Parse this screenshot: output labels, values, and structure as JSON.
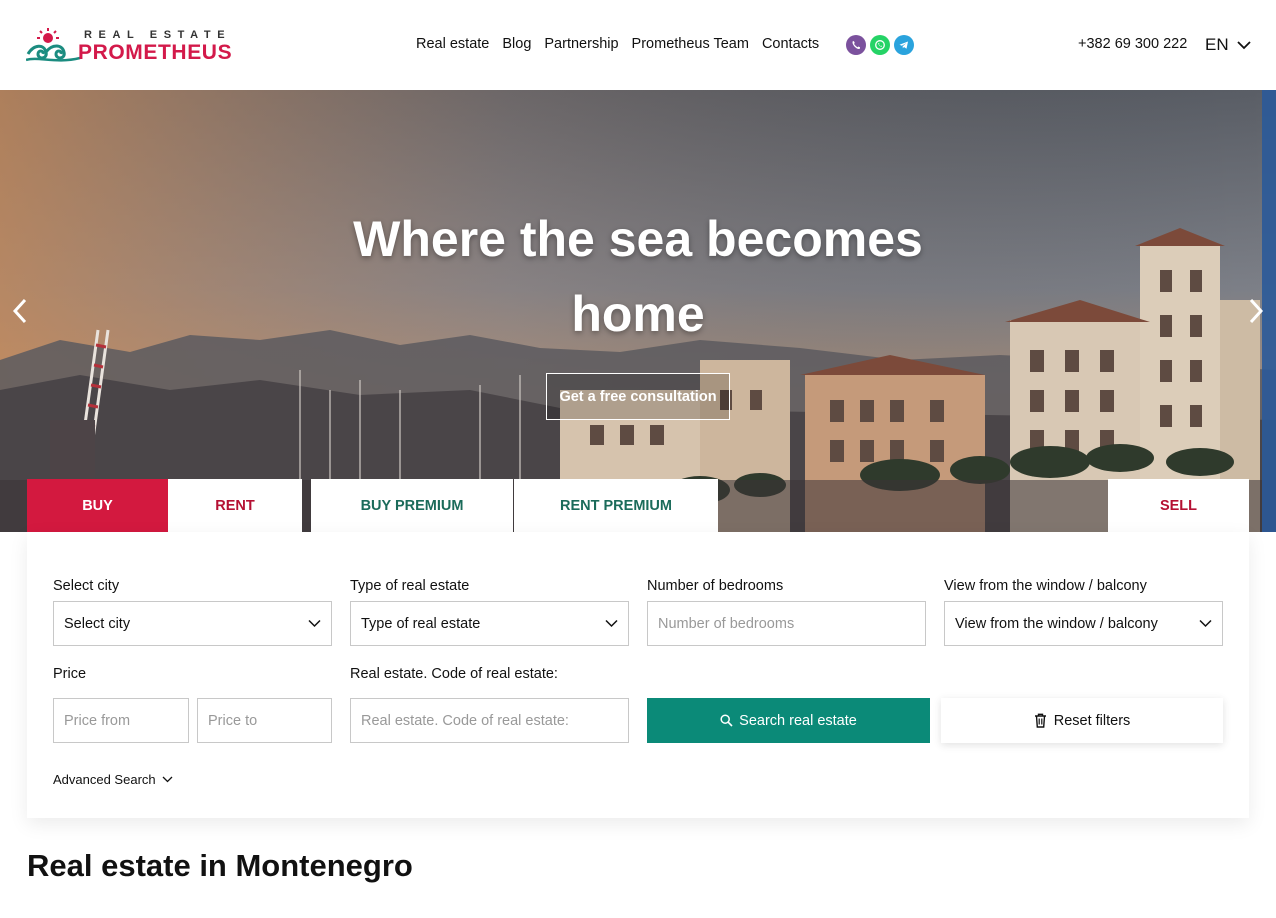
{
  "brand": {
    "tagline": "REAL ESTATE",
    "name": "PROMETHEUS",
    "colors": {
      "primary": "#d3193f",
      "teal": "#0b8a78",
      "dark_teal": "#1b6b5a"
    },
    "logo_icon": "sun-waves-logo"
  },
  "nav": {
    "items": [
      "Real estate",
      "Blog",
      "Partnership",
      "Prometheus Team",
      "Contacts"
    ]
  },
  "messengers": [
    {
      "icon": "viber-icon",
      "color": "#7b519d"
    },
    {
      "icon": "whatsapp-icon",
      "color": "#25d366"
    },
    {
      "icon": "telegram-icon",
      "color": "#2aa3dd"
    }
  ],
  "header": {
    "phone": "+382 69 300 222",
    "language": "EN"
  },
  "hero": {
    "title": "Where the sea becomes home",
    "cta": "Get a free consultation",
    "prev_icon": "chevron-left-icon",
    "next_icon": "chevron-right-icon"
  },
  "tabs": {
    "buy": "BUY",
    "rent": "RENT",
    "buy_premium": "BUY PREMIUM",
    "rent_premium": "RENT PREMIUM",
    "sell": "SELL",
    "active": "BUY"
  },
  "filters": {
    "city": {
      "label": "Select city",
      "value": "Select city"
    },
    "type": {
      "label": "Type of real estate",
      "value": "Type of real estate"
    },
    "bedrooms": {
      "label": "Number of bedrooms",
      "placeholder": "Number of bedrooms"
    },
    "view": {
      "label": "View from the window / balcony",
      "value": "View from the window / balcony"
    },
    "price": {
      "label": "Price",
      "from_placeholder": "Price from",
      "to_placeholder": "Price to"
    },
    "code": {
      "label": "Real estate. Code of real estate:",
      "placeholder": "Real estate. Code of real estate:"
    },
    "search_button": "Search real estate",
    "reset_button": "Reset filters",
    "advanced": "Advanced Search"
  },
  "section": {
    "title": "Real estate in Montenegro"
  }
}
